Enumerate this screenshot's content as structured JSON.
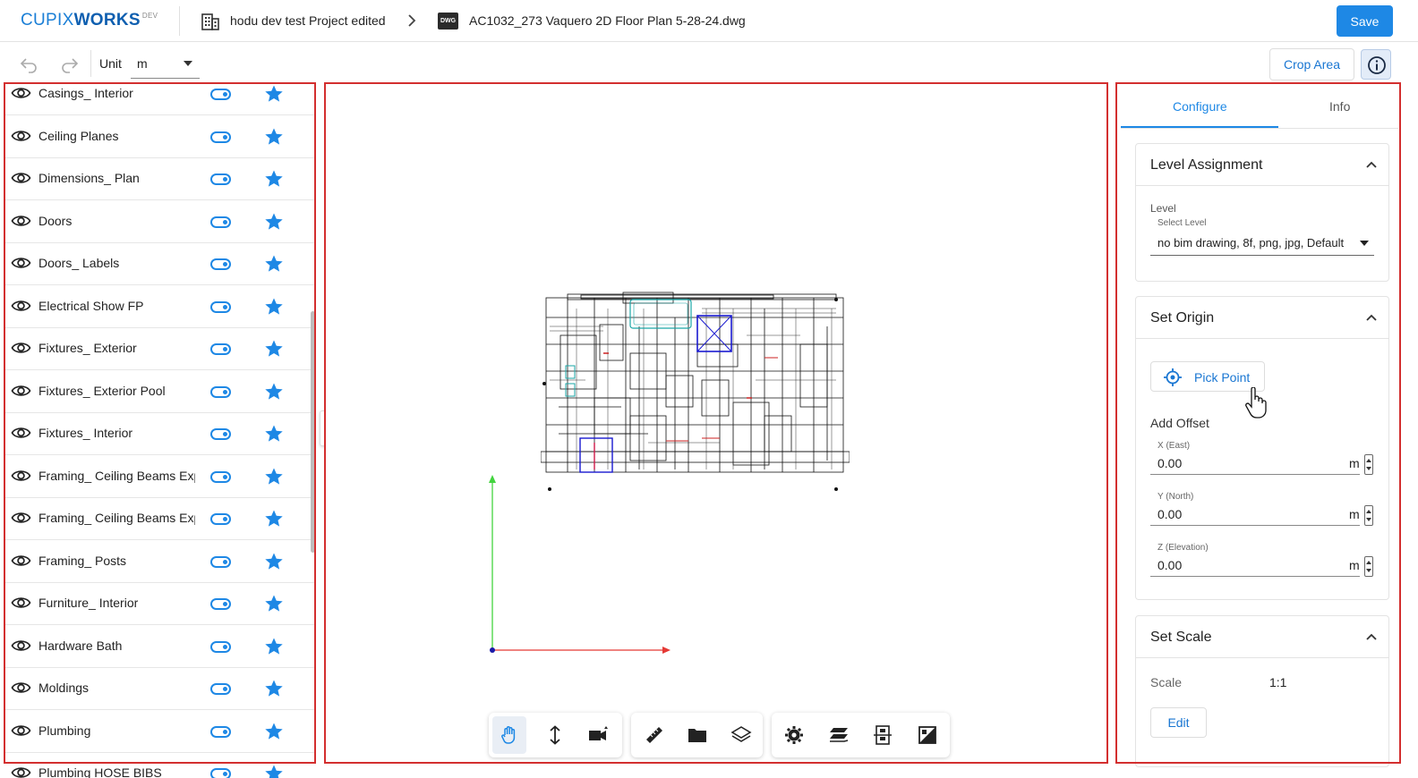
{
  "app": {
    "logo_main": "CUPIX",
    "logo_bold": "WORKS",
    "logo_sup": "DEV",
    "project_name": "hodu dev test Project edited",
    "file_badge": "DWG",
    "file_name": "AC1032_273 Vaquero 2D Floor Plan 5-28-24.dwg",
    "save_label": "Save"
  },
  "toolbar": {
    "unit_label": "Unit",
    "unit_value": "m",
    "crop_label": "Crop Area"
  },
  "layers": [
    {
      "label": "Casings_ Interior"
    },
    {
      "label": "Ceiling Planes"
    },
    {
      "label": "Dimensions_ Plan"
    },
    {
      "label": "Doors"
    },
    {
      "label": "Doors_ Labels"
    },
    {
      "label": "Electrical Show FP"
    },
    {
      "label": "Fixtures_ Exterior"
    },
    {
      "label": "Fixtures_ Exterior Pool"
    },
    {
      "label": "Fixtures_ Interior"
    },
    {
      "label": "Framing_ Ceiling Beams Exp"
    },
    {
      "label": "Framing_ Ceiling Beams Exp"
    },
    {
      "label": "Framing_ Posts"
    },
    {
      "label": "Furniture_ Interior"
    },
    {
      "label": "Hardware Bath"
    },
    {
      "label": "Moldings"
    },
    {
      "label": "Plumbing"
    },
    {
      "label": "Plumbing HOSE BIBS"
    }
  ],
  "right_panel": {
    "tab_configure": "Configure",
    "tab_info": "Info",
    "level_assignment": {
      "title": "Level Assignment",
      "level_label": "Level",
      "select_label": "Select Level",
      "select_value": "no bim drawing, 8f, png, jpg, Default"
    },
    "set_origin": {
      "title": "Set Origin",
      "pick_point": "Pick Point",
      "add_offset": "Add Offset",
      "x_label": "X (East)",
      "x_value": "0.00",
      "y_label": "Y (North)",
      "y_value": "0.00",
      "z_label": "Z (Elevation)",
      "z_value": "0.00",
      "unit": "m"
    },
    "set_scale": {
      "title": "Set Scale",
      "scale_label": "Scale",
      "scale_value": "1:1",
      "edit_label": "Edit"
    }
  },
  "colors": {
    "accent": "#1e88e5",
    "highlight_outline": "#d32f2f",
    "axis_x": "#e53935",
    "axis_y": "#43d43f",
    "axis_origin": "#1a1aa8"
  },
  "icons": [
    "building-icon",
    "chevron-right-icon",
    "undo-icon",
    "redo-icon",
    "info-icon",
    "eye-icon",
    "toggle-icon",
    "star-icon",
    "collapse-left-icon",
    "hand-pan-icon",
    "vertical-move-icon",
    "camera-icon",
    "ruler-icon",
    "folder-icon",
    "layers-icon",
    "settings-icon",
    "stack-icon",
    "level-icon",
    "crop-icon",
    "crosshair-icon",
    "chevron-up-icon"
  ]
}
